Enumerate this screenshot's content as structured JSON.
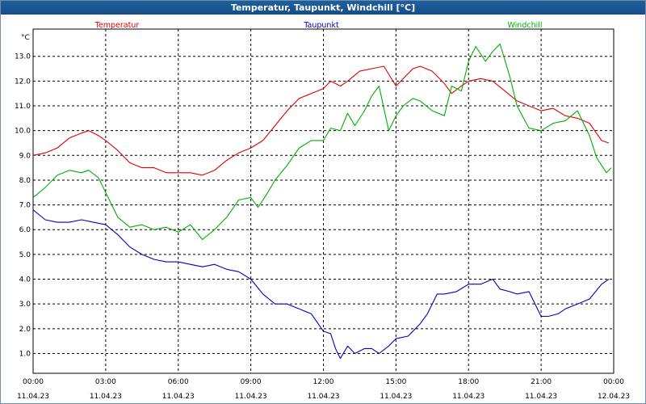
{
  "chart_data": {
    "type": "line",
    "title": "Temperatur, Taupunkt, Windchill [°C]",
    "ylabel": "°C",
    "ylim": [
      0.2,
      14.1
    ],
    "xlim": [
      0,
      24
    ],
    "grid": true,
    "legend_position": "top",
    "y_ticks": [
      "1.0",
      "2.0",
      "3.0",
      "4.0",
      "5.0",
      "6.0",
      "7.0",
      "8.0",
      "9.0",
      "10.0",
      "11.0",
      "12.0",
      "13.0"
    ],
    "x_ticks": [
      {
        "time": "00:00",
        "date": "11.04.23"
      },
      {
        "time": "03:00",
        "date": "11.04.23"
      },
      {
        "time": "06:00",
        "date": "11.04.23"
      },
      {
        "time": "09:00",
        "date": "11.04.23"
      },
      {
        "time": "12:00",
        "date": "11.04.23"
      },
      {
        "time": "15:00",
        "date": "11.04.23"
      },
      {
        "time": "18:00",
        "date": "11.04.23"
      },
      {
        "time": "21:00",
        "date": "11.04.23"
      },
      {
        "time": "00:00",
        "date": "12.04.23"
      }
    ],
    "series": [
      {
        "name": "Temperatur",
        "color": "#e00000",
        "x": [
          0,
          0.5,
          1,
          1.5,
          2,
          2.3,
          2.7,
          3,
          3.5,
          4,
          4.5,
          5,
          5.5,
          6,
          6.5,
          7,
          7.5,
          8,
          8.5,
          9,
          9.5,
          10,
          10.5,
          11,
          11.5,
          12,
          12.3,
          12.7,
          13,
          13.5,
          14,
          14.5,
          15,
          15.3,
          15.7,
          16,
          16.5,
          17,
          17.3,
          17.7,
          18,
          18.5,
          19,
          19.5,
          20,
          20.5,
          21,
          21.5,
          22,
          22.5,
          23,
          23.5,
          23.8
        ],
        "y": [
          9.0,
          9.1,
          9.3,
          9.7,
          9.9,
          10.0,
          9.8,
          9.6,
          9.2,
          8.7,
          8.5,
          8.5,
          8.3,
          8.3,
          8.3,
          8.2,
          8.4,
          8.8,
          9.1,
          9.3,
          9.6,
          10.2,
          10.8,
          11.3,
          11.5,
          11.7,
          12.0,
          11.8,
          12.0,
          12.4,
          12.5,
          12.6,
          11.8,
          12.1,
          12.5,
          12.6,
          12.4,
          11.9,
          11.5,
          11.8,
          12.0,
          12.1,
          12.0,
          11.6,
          11.2,
          11.0,
          10.8,
          10.9,
          10.6,
          10.5,
          10.3,
          9.6,
          9.5
        ]
      },
      {
        "name": "Taupunkt",
        "color": "#0000c0",
        "x": [
          0,
          0.5,
          1,
          1.5,
          2,
          2.5,
          3,
          3.5,
          4,
          4.5,
          5,
          5.5,
          6,
          6.5,
          7,
          7.5,
          8,
          8.5,
          9,
          9.5,
          10,
          10.5,
          11,
          11.5,
          12,
          12.3,
          12.5,
          12.7,
          13,
          13.3,
          13.7,
          14,
          14.3,
          14.7,
          15,
          15.5,
          16,
          16.3,
          16.7,
          17,
          17.5,
          18,
          18.5,
          19,
          19.3,
          19.7,
          20,
          20.5,
          21,
          21.3,
          21.7,
          22,
          22.5,
          23,
          23.5,
          23.8
        ],
        "y": [
          6.8,
          6.4,
          6.3,
          6.3,
          6.4,
          6.3,
          6.2,
          5.8,
          5.3,
          5.0,
          4.8,
          4.7,
          4.7,
          4.6,
          4.5,
          4.6,
          4.4,
          4.3,
          4.0,
          3.4,
          3.0,
          3.0,
          2.8,
          2.6,
          1.9,
          1.8,
          1.2,
          0.8,
          1.3,
          1.0,
          1.2,
          1.2,
          1.0,
          1.3,
          1.6,
          1.7,
          2.2,
          2.6,
          3.4,
          3.4,
          3.5,
          3.8,
          3.8,
          4.0,
          3.6,
          3.5,
          3.4,
          3.5,
          2.5,
          2.5,
          2.6,
          2.8,
          3.0,
          3.2,
          3.8,
          4.0
        ]
      },
      {
        "name": "Windchill",
        "color": "#00b000",
        "x": [
          0,
          0.5,
          1,
          1.5,
          2,
          2.3,
          2.7,
          3,
          3.5,
          4,
          4.5,
          5,
          5.5,
          6,
          6.5,
          7,
          7.5,
          8,
          8.5,
          9,
          9.3,
          9.7,
          10,
          10.5,
          11,
          11.5,
          12,
          12.3,
          12.7,
          13,
          13.3,
          13.7,
          14,
          14.3,
          14.7,
          15,
          15.3,
          15.7,
          16,
          16.5,
          17,
          17.3,
          17.7,
          18,
          18.3,
          18.7,
          19,
          19.3,
          19.7,
          20,
          20.5,
          21,
          21.5,
          22,
          22.5,
          23,
          23.3,
          23.7,
          23.9
        ],
        "y": [
          7.3,
          7.7,
          8.2,
          8.4,
          8.3,
          8.4,
          8.1,
          7.5,
          6.5,
          6.1,
          6.2,
          6.0,
          6.1,
          5.9,
          6.2,
          5.6,
          6.0,
          6.5,
          7.2,
          7.3,
          6.9,
          7.5,
          8.0,
          8.6,
          9.3,
          9.6,
          9.6,
          10.1,
          10.0,
          10.7,
          10.2,
          10.8,
          11.4,
          11.8,
          10.0,
          10.6,
          11.0,
          11.3,
          11.2,
          10.8,
          10.6,
          11.8,
          11.6,
          12.8,
          13.4,
          12.8,
          13.2,
          13.5,
          12.2,
          11.0,
          10.1,
          10.0,
          10.3,
          10.4,
          10.8,
          9.8,
          8.9,
          8.3,
          8.5
        ]
      }
    ]
  }
}
